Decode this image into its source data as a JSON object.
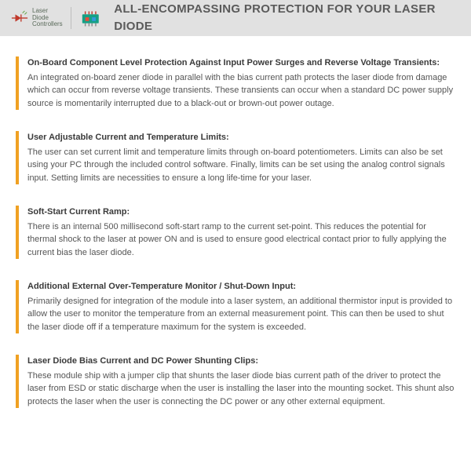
{
  "header": {
    "brand_line1": "Laser",
    "brand_line2": "Diode",
    "brand_line3": "Controllers",
    "title": "ALL-ENCOMPASSING PROTECTION FOR YOUR LASER DIODE"
  },
  "sections": [
    {
      "title": "On-Board Component Level Protection Against Input Power Surges and Reverse Voltage Transients:",
      "text": "An integrated on-board zener diode in parallel with the bias current path protects the laser diode from damage which can occur from reverse voltage transients.  These transients can occur when a standard DC power supply source is momentarily interrupted due to a black-out or brown-out power outage."
    },
    {
      "title": "User Adjustable Current and Temperature Limits:",
      "text": "The user can set current limit and temperature limits through on-board potentiometers.  Limits can also be set using your PC through the included control software.  Finally, limits can be set using the analog control signals input. Setting limits are necessities to ensure a long life-time for your laser."
    },
    {
      "title": "Soft-Start Current Ramp:",
      "text": "There is an internal 500 millisecond soft-start ramp to the current set-point. This reduces the potential for thermal shock to the laser at power ON and is used to ensure good electrical contact prior to fully applying the current bias the laser diode."
    },
    {
      "title": "Additional External Over-Temperature Monitor / Shut-Down Input:",
      "text": "Primarily designed for integration of the module into a laser system, an additional thermistor input is provided to allow the user to monitor the temperature from an external measurement point. This can then be used to shut the laser diode off if a temperature maximum for the system is exceeded."
    },
    {
      "title": "Laser Diode Bias Current and DC Power Shunting Clips:",
      "text": "These module ship with a jumper clip that shunts the laser diode bias current path of the driver to protect the laser from ESD or static discharge when the user is installing the laser into the mounting socket. This shunt also protects the laser when the user is connecting the DC power or any other external equipment."
    }
  ]
}
